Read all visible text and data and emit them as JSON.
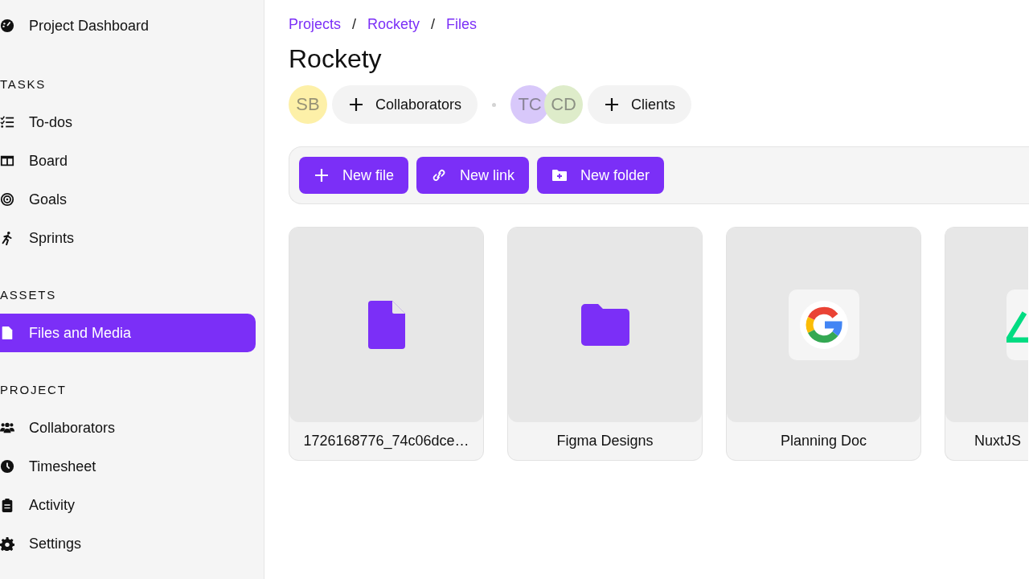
{
  "sidebar": {
    "top_item": {
      "label": "Project Dashboard",
      "kind": "dashboard",
      "selected": false
    },
    "sections": [
      {
        "heading": "TASKS",
        "items": [
          {
            "label": "To-dos",
            "kind": "todos",
            "selected": false
          },
          {
            "label": "Board",
            "kind": "board",
            "selected": false
          },
          {
            "label": "Goals",
            "kind": "goals",
            "selected": false
          },
          {
            "label": "Sprints",
            "kind": "sprints",
            "selected": false
          }
        ]
      },
      {
        "heading": "ASSETS",
        "items": [
          {
            "label": "Files and Media",
            "kind": "file",
            "selected": true
          }
        ]
      },
      {
        "heading": "PROJECT",
        "items": [
          {
            "label": "Collaborators",
            "kind": "people",
            "selected": false
          },
          {
            "label": "Timesheet",
            "kind": "clock",
            "selected": false
          },
          {
            "label": "Activity",
            "kind": "clipboard",
            "selected": false
          },
          {
            "label": "Settings",
            "kind": "gear",
            "selected": false
          }
        ]
      }
    ]
  },
  "breadcrumb": [
    {
      "text": "Projects",
      "kind": "link"
    },
    {
      "text": "/",
      "kind": "separator"
    },
    {
      "text": "Rockety",
      "kind": "link"
    },
    {
      "text": "/",
      "kind": "separator"
    },
    {
      "text": "Files",
      "kind": "link"
    }
  ],
  "title": "Rockety",
  "collaborators": {
    "avatars": [
      {
        "initials": "SB",
        "color": "#fdf0a8"
      }
    ],
    "add_button": "Collaborators"
  },
  "clients": {
    "avatars": [
      {
        "initials": "TC",
        "color": "#d8c8fa"
      },
      {
        "initials": "CD",
        "color": "#deecca"
      }
    ],
    "add_button": "Clients"
  },
  "toolbar": [
    {
      "label": "New file",
      "kind": "plus"
    },
    {
      "label": "New link",
      "kind": "link"
    },
    {
      "label": "New folder",
      "kind": "folder"
    }
  ],
  "files": [
    {
      "name": "1726168776_74c06dce…",
      "kind": "file"
    },
    {
      "name": "Figma Designs",
      "kind": "folder"
    },
    {
      "name": "Planning Doc",
      "kind": "doc"
    },
    {
      "name": "NuxtJS",
      "kind": "app"
    }
  ]
}
